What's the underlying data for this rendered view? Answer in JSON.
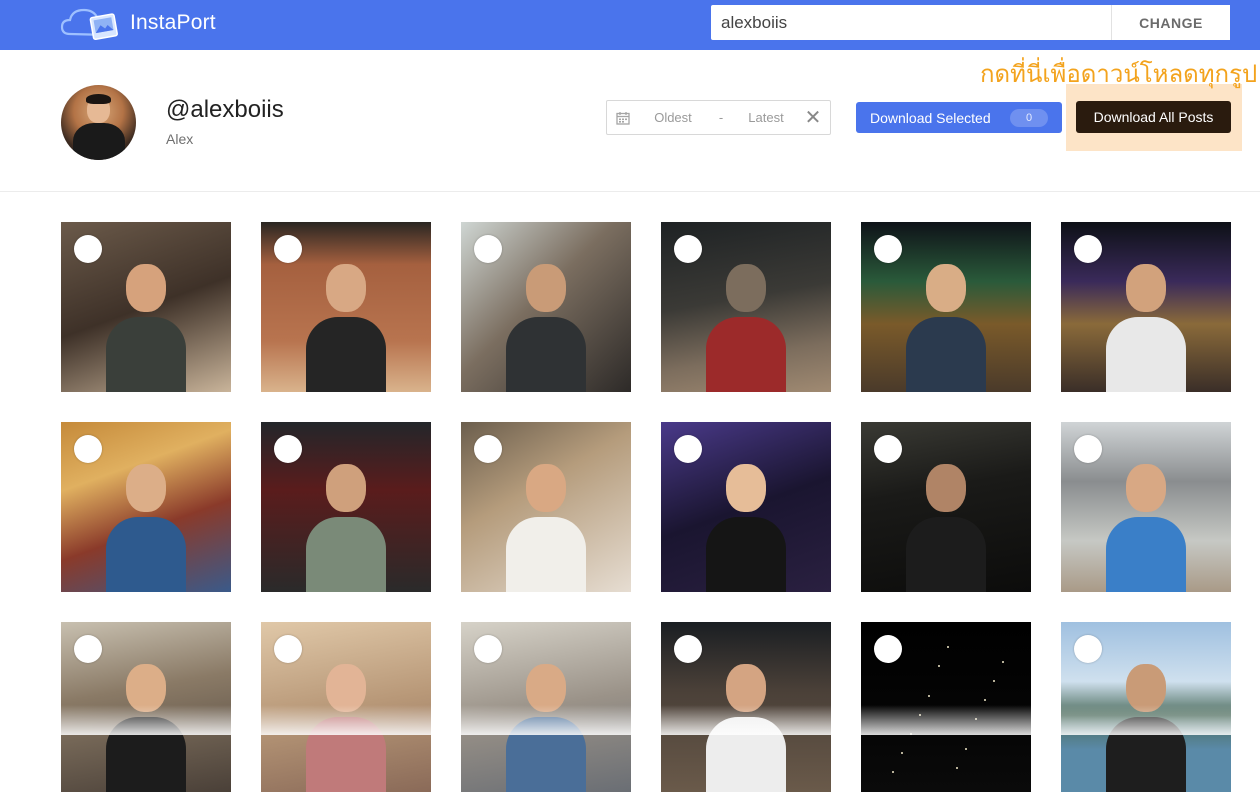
{
  "app": {
    "name": "InstaPort",
    "brand_color": "#4a74ec"
  },
  "search": {
    "value": "alexboiis",
    "change_label": "CHANGE"
  },
  "profile": {
    "username": "@alexboiis",
    "full_name": "Alex"
  },
  "date_range": {
    "from_placeholder": "Oldest",
    "separator": "-",
    "to_placeholder": "Latest"
  },
  "actions": {
    "download_selected_label": "Download Selected",
    "selected_count": "0",
    "download_all_label": "Download All Posts",
    "annotation_text": "กดที่นี่เพื่อดาวน์โหลดทุกรูป",
    "annotation_color": "#f3a31d"
  },
  "photos": [
    {
      "scene": "cake dessert cafe",
      "bg": "linear-gradient(160deg,#6b5a4a,#3e3128 50%,#c9b49a)",
      "head": "#d6a27c",
      "body": "#3a3f3a",
      "selected": false
    },
    {
      "scene": "brick wall portrait",
      "bg": "linear-gradient(180deg,#2a2622 0%,#a5603f 25%,#b8744f 70%,#d9b38c 100%)",
      "head": "#d8a884",
      "body": "#252525",
      "selected": false
    },
    {
      "scene": "reading in cafe",
      "bg": "linear-gradient(135deg,#cfd6d3,#7b6e60 45%,#2d2a28)",
      "head": "#c99b77",
      "body": "#2f3234",
      "selected": false
    },
    {
      "scene": "gym interior",
      "bg": "linear-gradient(170deg,#1e2224,#3b3a36 45%,#7c6d5d 75%,#a08a72)",
      "head": "#7c6d5d",
      "body": "#9c2a2a",
      "selected": false
    },
    {
      "scene": "night carnival",
      "bg": "linear-gradient(180deg,#0e1218,#2a5a3a 35%,#7a5a2a 60%,#4a3a2a)",
      "head": "#d9ad86",
      "body": "#2b3a4e",
      "selected": false
    },
    {
      "scene": "night fair crowd",
      "bg": "linear-gradient(180deg,#0d1016,#3a2a5a 35%,#8a6a3a 60%,#3a2e28)",
      "head": "#d2a27c",
      "body": "#e8e8e8",
      "selected": false
    },
    {
      "scene": "temple selfie",
      "bg": "linear-gradient(160deg,#c58a3a,#e0b060 30%,#8a3a2a 60%,#3a5a8a)",
      "head": "#dcae88",
      "body": "#2e5a8e",
      "selected": false
    },
    {
      "scene": "gym equipment",
      "bg": "linear-gradient(180deg,#23262a,#5a1c1c 40%,#2a2a2a)",
      "head": "#cfa07c",
      "body": "#7a8a78",
      "selected": false
    },
    {
      "scene": "selfie on table",
      "bg": "linear-gradient(150deg,#6b5e4d,#b59c7c 40%,#e6ddd2)",
      "head": "#d9a883",
      "body": "#f1efea",
      "selected": false
    },
    {
      "scene": "party group selfie",
      "bg": "linear-gradient(160deg,#4a3a8a,#1a1530 50%,#2a2040)",
      "head": "#e6bd98",
      "body": "#151515",
      "selected": false
    },
    {
      "scene": "dark lounge",
      "bg": "linear-gradient(170deg,#3a3a34,#1a1a18 40%,#0c0c0b)",
      "head": "#b08466",
      "body": "#1c1c1c",
      "selected": false
    },
    {
      "scene": "gym ball",
      "bg": "linear-gradient(180deg,#d0d4d6,#8a8d8f 35%,#c6c8c4 70%,#a99a87)",
      "head": "#d8a884",
      "body": "#3a7fc8",
      "selected": false
    },
    {
      "scene": "mall selfie",
      "bg": "linear-gradient(170deg,#c8c0b0,#8a7a66 40%,#4a4038)",
      "head": "#dcae88",
      "body": "#1c1c1c",
      "selected": false
    },
    {
      "scene": "old photo baby",
      "bg": "linear-gradient(170deg,#e0c8a8,#b89878 50%,#8a6a58)",
      "head": "#e2b496",
      "body": "#c07a7a",
      "selected": false
    },
    {
      "scene": "with pomeranian",
      "bg": "linear-gradient(170deg,#d6d2c8,#9a9288 50%,#6a6e74)",
      "head": "#d9aa86",
      "body": "#4a6e98",
      "selected": false
    },
    {
      "scene": "outdoor evening",
      "bg": "linear-gradient(180deg,#1a1e22,#4a4038 40%,#6a5a4a)",
      "head": "#d4a482",
      "body": "#ededed",
      "selected": false
    },
    {
      "scene": "night sky lanterns",
      "bg": "linear-gradient(180deg,#000000,#050505 60%,#0a0a0a)",
      "head": "#000000",
      "body": "#000000",
      "selected": false
    },
    {
      "scene": "mountain lake",
      "bg": "linear-gradient(180deg,#9fc0e0,#cfe0ee 35%,#4a6a5a 55%,#5a8aa8 75%)",
      "head": "#c99b77",
      "body": "#1e1e1e",
      "selected": false
    }
  ]
}
